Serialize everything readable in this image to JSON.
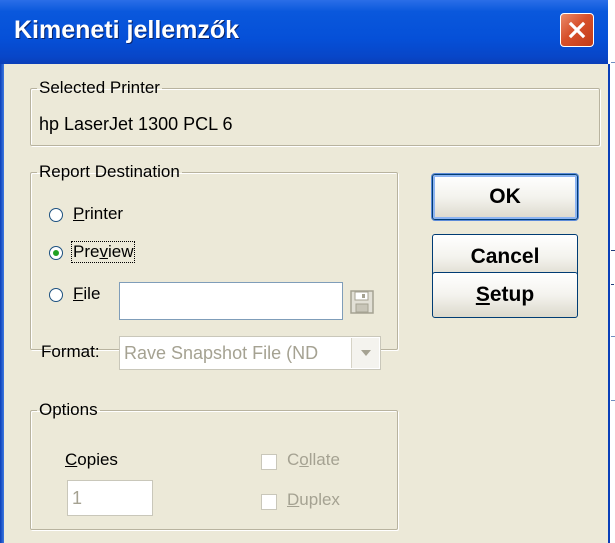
{
  "window": {
    "title": "Kimeneti jellemzők",
    "colors": {
      "titlebar": "#0550d8",
      "close_button": "#d7502b",
      "dialog_bg": "#ece9d8"
    }
  },
  "selected_printer": {
    "group_label": "Selected Printer",
    "printer_name": "hp LaserJet 1300 PCL 6"
  },
  "report_destination": {
    "group_label": "Report Destination",
    "options": [
      {
        "label_first": "P",
        "label_rest": "rinter",
        "selected": false
      },
      {
        "label_first": "Pre",
        "label_mnemonic": "v",
        "label_rest": "iew",
        "selected": true
      },
      {
        "label_first": "F",
        "label_rest": "ile",
        "selected": false
      }
    ],
    "file_value": "",
    "format_label": "Format:",
    "format_value": "Rave Snapshot File (ND"
  },
  "buttons": {
    "ok": "OK",
    "cancel": "Cancel",
    "setup_mnemonic": "S",
    "setup_rest": "etup"
  },
  "options": {
    "group_label": "Options",
    "copies_mnemonic": "C",
    "copies_rest": "opies",
    "copies_value": "1",
    "collate_first": "C",
    "collate_mnemonic": "o",
    "collate_rest": "llate",
    "duplex_mnemonic": "D",
    "duplex_rest": "uplex"
  },
  "icons": [
    "close-icon",
    "save-icon",
    "dropdown-arrow-icon"
  ]
}
